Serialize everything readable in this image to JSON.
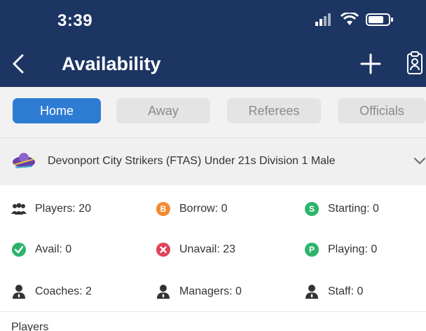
{
  "status": {
    "time": "3:39"
  },
  "nav": {
    "title": "Availability"
  },
  "tabs": [
    {
      "label": "Home",
      "active": true
    },
    {
      "label": "Away",
      "active": false
    },
    {
      "label": "Referees",
      "active": false
    },
    {
      "label": "Officials",
      "active": false
    }
  ],
  "team": {
    "name": "Devonport City Strikers (FTAS) Under 21s Division 1 Male",
    "logo_icon": "team-logo-icon"
  },
  "stats": {
    "players": {
      "label": "Players: 20",
      "icon": "players-group-icon"
    },
    "borrow": {
      "label": "Borrow: 0",
      "badge": "B",
      "color": "#f28b30"
    },
    "starting": {
      "label": "Starting: 0",
      "badge": "S",
      "color": "#2db36b"
    },
    "avail": {
      "label": "Avail: 0",
      "icon": "check-circle-icon",
      "color": "#2db36b"
    },
    "unavail": {
      "label": "Unavail: 23",
      "icon": "x-circle-icon",
      "color": "#e0435a"
    },
    "playing": {
      "label": "Playing: 0",
      "badge": "P",
      "color": "#2db36b"
    },
    "coaches": {
      "label": "Coaches: 2",
      "icon": "person-icon"
    },
    "managers": {
      "label": "Managers: 0",
      "icon": "person-icon"
    },
    "staff": {
      "label": "Staff: 0",
      "icon": "person-icon"
    }
  },
  "section": {
    "players_heading": "Players"
  },
  "colors": {
    "header": "#1d3563",
    "accent": "#2e7bd3"
  }
}
